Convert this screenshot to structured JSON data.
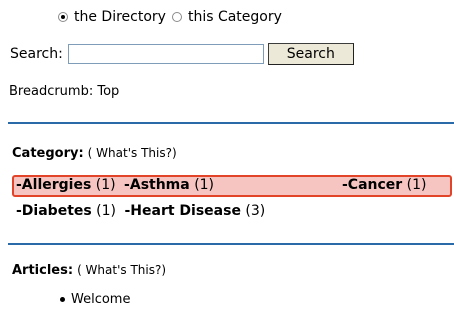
{
  "scope": {
    "options": [
      {
        "label": "the Directory",
        "checked": true
      },
      {
        "label": "this Category",
        "checked": false
      }
    ]
  },
  "search": {
    "label": "Search:",
    "value": "",
    "button_label": "Search"
  },
  "breadcrumb": {
    "text": "Breadcrumb:  Top"
  },
  "category_section": {
    "title": "Category:",
    "whats_this": "( What's This?)",
    "items": [
      {
        "name": "-Allergies",
        "count": "(1)"
      },
      {
        "name": "-Asthma",
        "count": "(1)"
      },
      {
        "name": "-Cancer",
        "count": "(1)"
      },
      {
        "name": "-Diabetes",
        "count": "(1)"
      },
      {
        "name": "-Heart Disease",
        "count": "(3)"
      }
    ]
  },
  "articles_section": {
    "title": "Articles:",
    "whats_this": "( What's This?)",
    "items": [
      "Welcome"
    ]
  },
  "colors": {
    "divider": "#2a6aa8",
    "highlight_fill": "#f7c5c1",
    "highlight_border": "#e2442a"
  }
}
